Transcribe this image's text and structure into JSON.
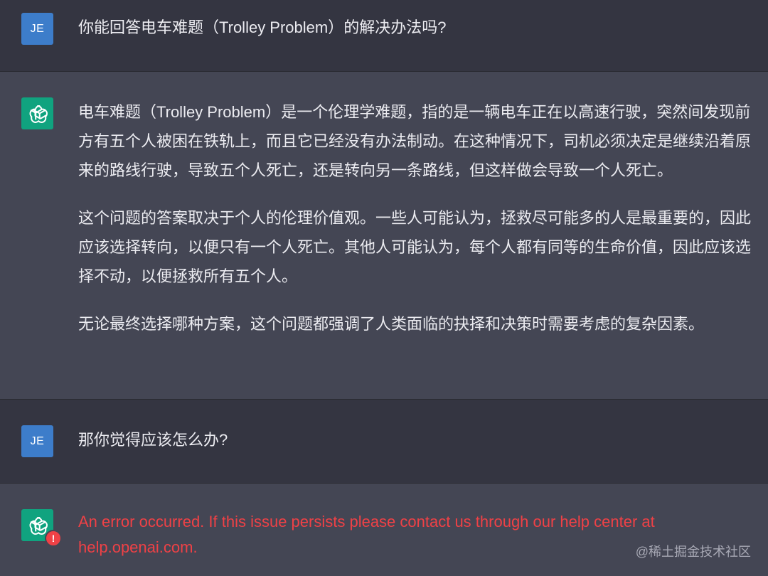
{
  "conversation": {
    "q1": {
      "avatar": "JE",
      "text": "你能回答电车难题（Trolley Problem）的解决办法吗?"
    },
    "a1": {
      "avatar_icon": "openai-logo-icon",
      "paragraphs": [
        "电车难题（Trolley Problem）是一个伦理学难题，指的是一辆电车正在以高速行驶，突然间发现前方有五个人被困在铁轨上，而且它已经没有办法制动。在这种情况下，司机必须决定是继续沿着原来的路线行驶，导致五个人死亡，还是转向另一条路线，但这样做会导致一个人死亡。",
        "这个问题的答案取决于个人的伦理价值观。一些人可能认为，拯救尽可能多的人是最重要的，因此应该选择转向，以便只有一个人死亡。其他人可能认为，每个人都有同等的生命价值，因此应该选择不动，以便拯救所有五个人。",
        "无论最终选择哪种方案，这个问题都强调了人类面临的抉择和决策时需要考虑的复杂因素。"
      ]
    },
    "q2": {
      "avatar": "JE",
      "text": "那你觉得应该怎么办?"
    },
    "a2": {
      "avatar_icon": "openai-logo-icon",
      "error_badge": "!",
      "error_text": "An error occurred. If this issue persists please contact us through our help center at help.openai.com."
    }
  },
  "watermark": "@稀土掘金技术社区",
  "colors": {
    "user_bg": "#343541",
    "assistant_bg": "#444654",
    "user_avatar": "#3d7dca",
    "bot_avatar": "#10a37f",
    "error": "#ef4146",
    "text": "#ececf1"
  }
}
